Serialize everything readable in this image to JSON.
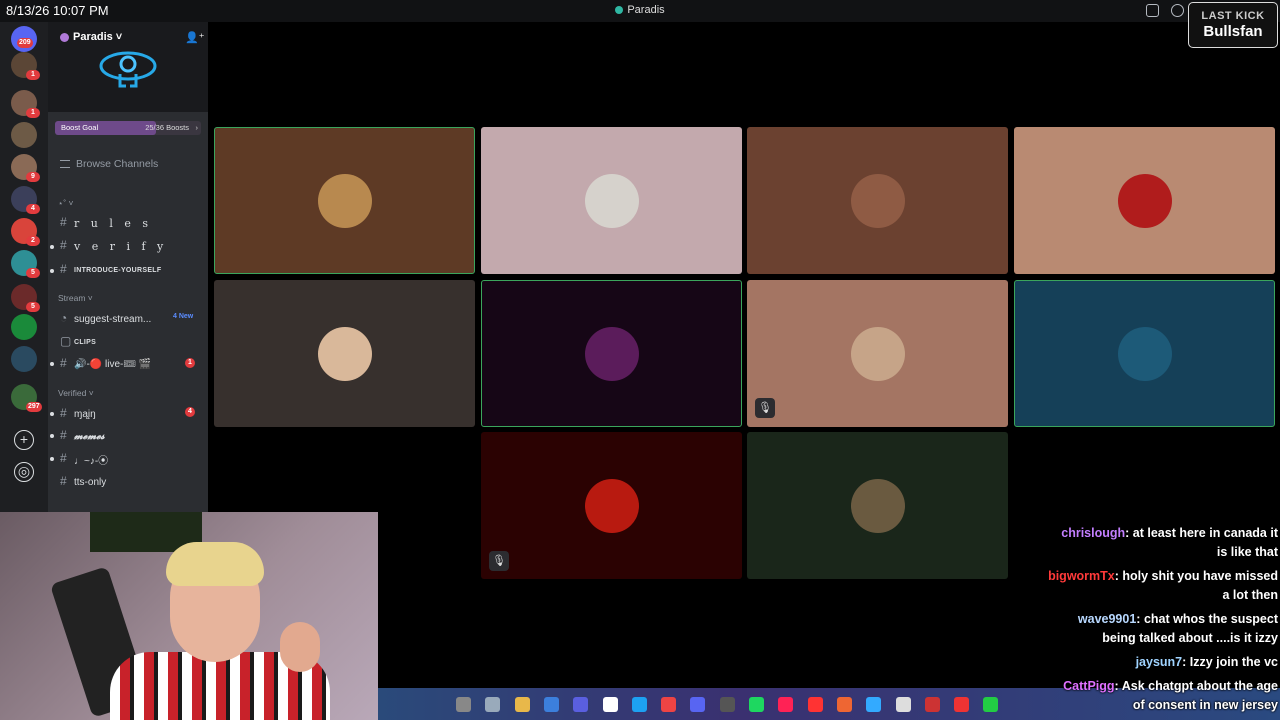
{
  "topbar": {
    "clock": "8/13/26 10:07 PM",
    "window_title": "Paradis"
  },
  "overlay": {
    "last_kick_label": "LAST KICK",
    "last_kick_name": "Bullsfan"
  },
  "server_rail": {
    "dm_badge": "209",
    "servers": [
      {
        "badge": "1",
        "color": "#5b4636"
      },
      {
        "badge": "1",
        "color": "#7a5b4b"
      },
      {
        "badge": "",
        "color": "#6d5a46"
      },
      {
        "badge": "9",
        "color": "#8a6a56"
      },
      {
        "badge": "4",
        "color": "#3b3f5a"
      },
      {
        "badge": "2",
        "color": "#d9443b"
      },
      {
        "badge": "5",
        "color": "#2e8f95"
      },
      {
        "badge": "5",
        "color": "#6b2a2a"
      },
      {
        "badge": "",
        "color": "#1a8a3a"
      },
      {
        "badge": "",
        "color": "#2a4a60"
      },
      {
        "badge": "297",
        "color": "#3a6a3a"
      }
    ]
  },
  "sidebar": {
    "server_name": "Paradis",
    "boost": {
      "label": "Boost Goal",
      "count": "25/36 Boosts",
      "progress": 0.694
    },
    "browse_label": "Browse Channels",
    "categories": {
      "first": "⋆˚",
      "stream": "Stream",
      "verified": "Verified"
    },
    "channels": {
      "rules": "r u l e s",
      "verify": "v e r i f y",
      "introduce": "INTRODUCE-YOURSELF",
      "suggest": "suggest-stream...",
      "suggest_new": "4 New",
      "clips": "CLIPS",
      "live": "🔊-🔴 live-🎟 🎬",
      "live_badge": "1",
      "main": "ɱąįŋ",
      "main_badge": "4",
      "memes": "𝓶𝓮𝓶𝓮𝓼",
      "music": "♩~♪-⦿",
      "tts": "tts-only"
    }
  },
  "grid": {
    "tiles": [
      {
        "bg": "#5e3a25",
        "avatar": "#b8894f"
      },
      {
        "bg": "#c3a9ad",
        "avatar": "#d6d2cc"
      },
      {
        "bg": "#6b4130",
        "avatar": "#8f5b44"
      },
      {
        "bg": "#b98a72",
        "avatar": "#b01c1c"
      },
      {
        "bg": "#37302d",
        "avatar": "#d9b89a"
      },
      {
        "bg": "#160616",
        "avatar": "#5b1c5b"
      },
      {
        "bg": "#a47563",
        "avatar": "#c6a488"
      },
      {
        "bg": "#154058",
        "avatar": "#1d5a78"
      },
      {
        "bg": "#2b0202",
        "avatar": "#b81a10"
      },
      {
        "bg": "#1a261a",
        "avatar": "#6a5a40"
      }
    ]
  },
  "chat": [
    {
      "user": "chrislough",
      "user_color": "#c37fff",
      "text": "at least here in canada it is like that"
    },
    {
      "user": "bigwormTx",
      "user_color": "#ff3a3a",
      "text": "holy shit you have missed a lot then"
    },
    {
      "user": "wave9901",
      "user_color": "#b8d8ff",
      "text": "chat whos the suspect being talked about ....is it izzy"
    },
    {
      "user": "jaysun7",
      "user_color": "#9fd3ff",
      "text": "Izzy join the vc"
    },
    {
      "user": "CattPigg",
      "user_color": "#e070ff",
      "text": "Ask chatgpt about the age of consent in new jersey"
    }
  ]
}
